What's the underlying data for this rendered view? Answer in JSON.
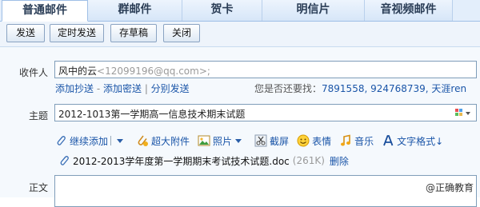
{
  "tabs": [
    {
      "label": "普通邮件",
      "active": true
    },
    {
      "label": "群邮件",
      "active": false
    },
    {
      "label": "贺卡",
      "active": false
    },
    {
      "label": "明信片",
      "active": false
    },
    {
      "label": "音视频邮件",
      "active": false
    }
  ],
  "toolbar": {
    "send": "发送",
    "scheduled_send": "定时发送",
    "save_draft": "存草稿",
    "close": "关闭"
  },
  "recipient": {
    "label": "收件人",
    "name": "风中的云",
    "address": "<12099196@qq.com>;"
  },
  "recipient_links": {
    "add_cc": "添加抄送",
    "dash1": " - ",
    "add_bcc": "添加密送",
    "bar": " | ",
    "separate_send": "分别发送"
  },
  "suggest": {
    "prompt": "您是否还要找：",
    "contacts": "7891558, 924768739, 天涯ren"
  },
  "subject": {
    "label": "主题",
    "value": "2012-1013第一学期高一信息技术期末试题"
  },
  "attach_toolbar": {
    "continue_add": "继续添加",
    "large_attachment": "超大附件",
    "photo": "照片",
    "screenshot": "截屏",
    "emoticon": "表情",
    "music": "音乐",
    "text_format": "文字格式↓"
  },
  "attachment": {
    "filename": "2012-2013学年度第一学期期末考试技术试题.doc",
    "size": "(261K)",
    "delete": "删除"
  },
  "body": {
    "label": "正文"
  },
  "watermark": "@正确教育"
}
